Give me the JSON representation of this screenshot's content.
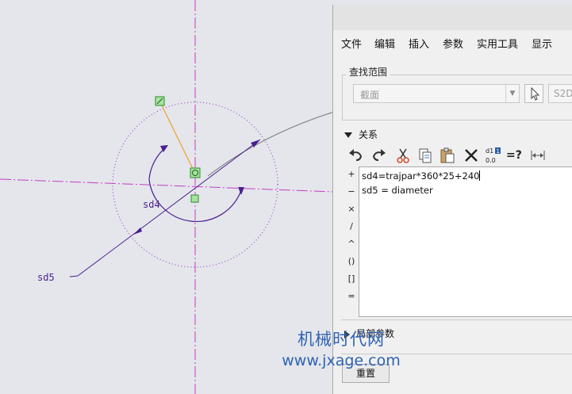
{
  "sketch": {
    "dim_labels": [
      "sd4",
      "sd5"
    ]
  },
  "menu": [
    "文件",
    "编辑",
    "插入",
    "参数",
    "实用工具",
    "显示"
  ],
  "search": {
    "group_label": "查找范围",
    "scope_value": "截面",
    "filter_value": "S2D"
  },
  "relations": {
    "section_label": "关系",
    "toolbar": [
      "undo-icon",
      "redo-icon",
      "cut-icon",
      "copy-icon",
      "paste-icon",
      "delete-icon",
      "switch-dimensions-icon",
      "evaluate-icon",
      "sort-relations-icon"
    ],
    "evaluate_label": "=?",
    "operators": [
      "+",
      "−",
      "×",
      "/",
      "^",
      "()",
      "[]",
      "="
    ],
    "lines": [
      "sd4=trajpar*360*25+240",
      "sd5 = diameter"
    ]
  },
  "local_params": {
    "label": "局部参数"
  },
  "buttons": {
    "reset_label": "重置"
  },
  "watermark": {
    "line1": "机械时代网",
    "line2": "www.jxage.com"
  },
  "colors": {
    "centerline": "#c63dc6",
    "geometry": "#4a1f8f",
    "construction": "#f0a030",
    "circle": "#a049c8"
  }
}
